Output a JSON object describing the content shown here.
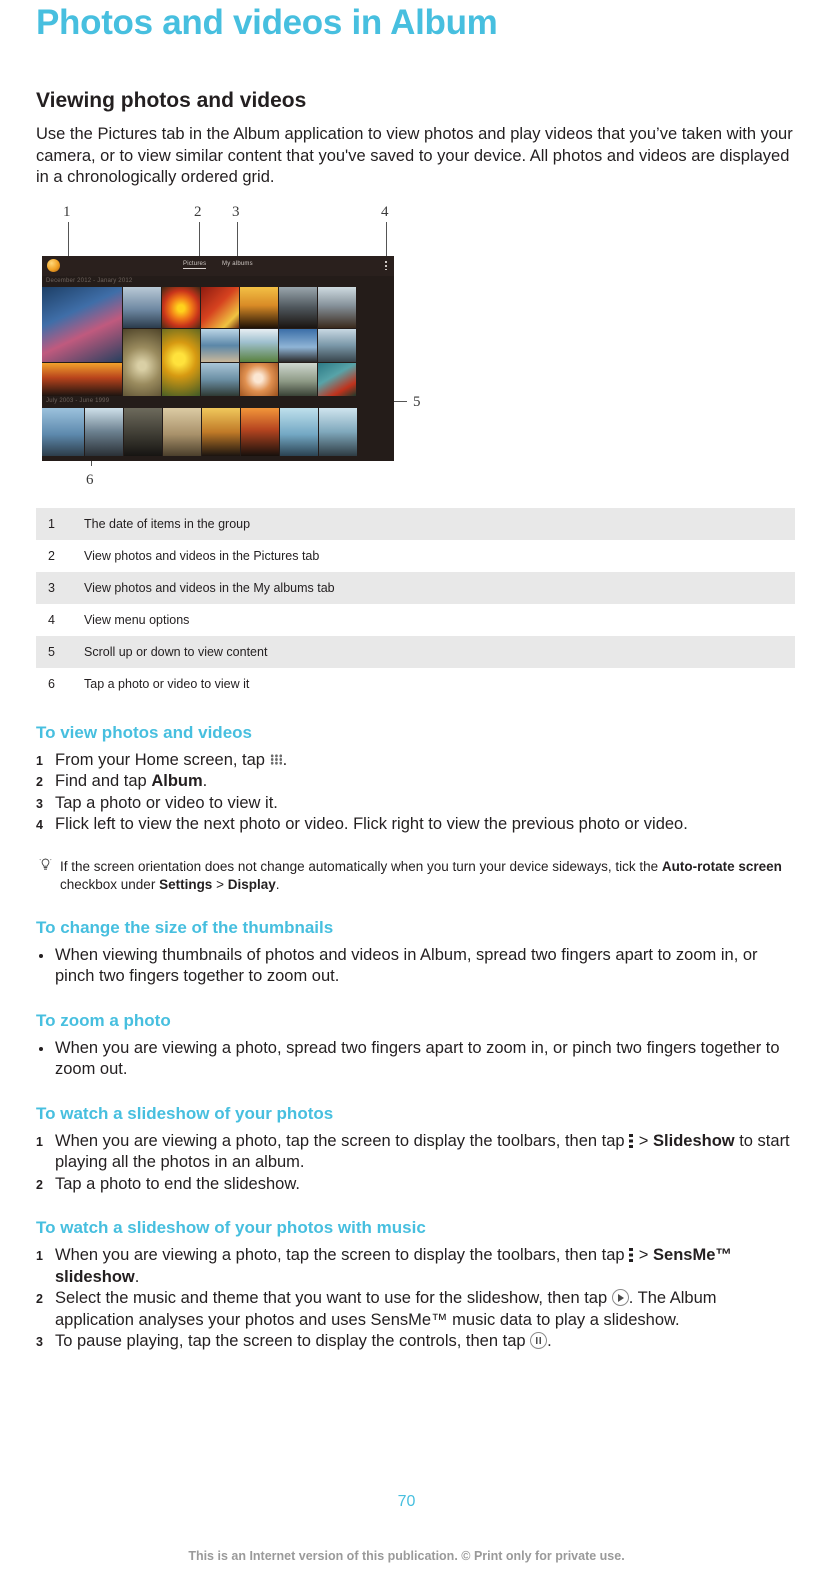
{
  "document": {
    "title": "Photos and videos in Album",
    "page_number": "70",
    "footer": "This is an Internet version of this publication. © Print only for private use.",
    "accent_color": "#47bfdf"
  },
  "section_viewing": {
    "heading": "Viewing photos and videos",
    "intro": "Use the Pictures tab in the Album application to view photos and play videos that you’ve taken with your camera, or to view similar content that you've saved to your device. All photos and videos are displayed in a chronologically ordered grid."
  },
  "figure": {
    "alt": "Album app thumbnail grid with numbered callouts",
    "callout_numbers": [
      "1",
      "2",
      "3",
      "4",
      "5",
      "6"
    ],
    "device": {
      "tabs": [
        "Pictures",
        "My albums"
      ],
      "active_tab": "Pictures",
      "date_group_top": "December 2012 - Janary 2012",
      "date_group_bottom": "July 2003 - June 1999",
      "menu_icon": "kebab-menu-icon",
      "logo_icon": "album-app-icon"
    }
  },
  "callout_table": {
    "rows": [
      {
        "num": "1",
        "text": "The date of items in the group"
      },
      {
        "num": "2",
        "text": "View photos and videos in the Pictures tab"
      },
      {
        "num": "3",
        "text": "View photos and videos in the My albums tab"
      },
      {
        "num": "4",
        "text": "View menu options"
      },
      {
        "num": "5",
        "text": "Scroll up or down to view content"
      },
      {
        "num": "6",
        "text": "Tap a photo or video to view it"
      }
    ]
  },
  "section_view_photos": {
    "heading": "To view photos and videos",
    "steps": {
      "s1_a": "From your Home screen, tap ",
      "s1_icon": "app-drawer-icon",
      "s1_b": ".",
      "s2_a": "Find and tap ",
      "s2_bold": "Album",
      "s2_b": ".",
      "s3": "Tap a photo or video to view it.",
      "s4": "Flick left to view the next photo or video. Flick right to view the previous photo or video."
    },
    "tip": {
      "icon": "light-bulb-icon",
      "a": "If the screen orientation does not change automatically when you turn your device sideways, tick the ",
      "b1": "Auto-rotate screen",
      "b": " checkbox under ",
      "b2": "Settings",
      "c": " > ",
      "b3": "Display",
      "d": "."
    }
  },
  "section_thumbnail_size": {
    "heading": "To change the size of the thumbnails",
    "bullet": "When viewing thumbnails of photos and videos in Album, spread two fingers apart to zoom in, or pinch two fingers together to zoom out."
  },
  "section_zoom_photo": {
    "heading": "To zoom a photo",
    "bullet": "When you are viewing a photo, spread two fingers apart to zoom in, or pinch two fingers together to zoom out."
  },
  "section_slideshow": {
    "heading": "To watch a slideshow of your photos",
    "steps": {
      "s1_a": "When you are viewing a photo, tap the screen to display the toolbars, then tap ",
      "s1_icon": "kebab-menu-icon",
      "s1_b": " > ",
      "s1_bold": "Slideshow",
      "s1_c": " to start playing all the photos in an album.",
      "s2": "Tap a photo to end the slideshow."
    }
  },
  "section_slideshow_music": {
    "heading": "To watch a slideshow of your photos with music",
    "steps": {
      "s1_a": "When you are viewing a photo, tap the screen to display the toolbars, then tap ",
      "s1_icon": "kebab-menu-icon",
      "s1_b": " > ",
      "s1_bold": "SensMe™ slideshow",
      "s1_c": ".",
      "s2_a": "Select the music and theme that you want to use for the slideshow, then tap ",
      "s2_icon": "play-circle-icon",
      "s2_b": ". The Album application analyses your photos and uses SensMe™ music data to play a slideshow.",
      "s3_a": "To pause playing, tap the screen to display the controls, then tap ",
      "s3_icon": "pause-circle-icon",
      "s3_b": "."
    }
  }
}
